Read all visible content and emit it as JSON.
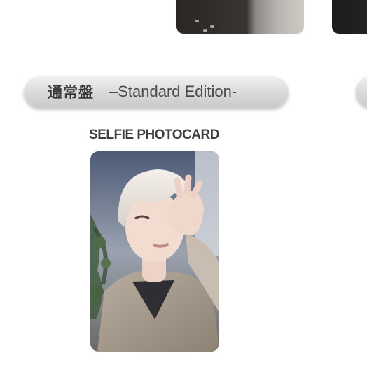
{
  "edition": {
    "title_jp": "通常盤",
    "title_en": "–Standard Edition-"
  },
  "photocard": {
    "caption": "SELFIE PHOTOCARD",
    "image_icon": "selfie-photo"
  },
  "colors": {
    "banner_text": "#3a3a3a",
    "caption_text": "#3e3e3e"
  }
}
